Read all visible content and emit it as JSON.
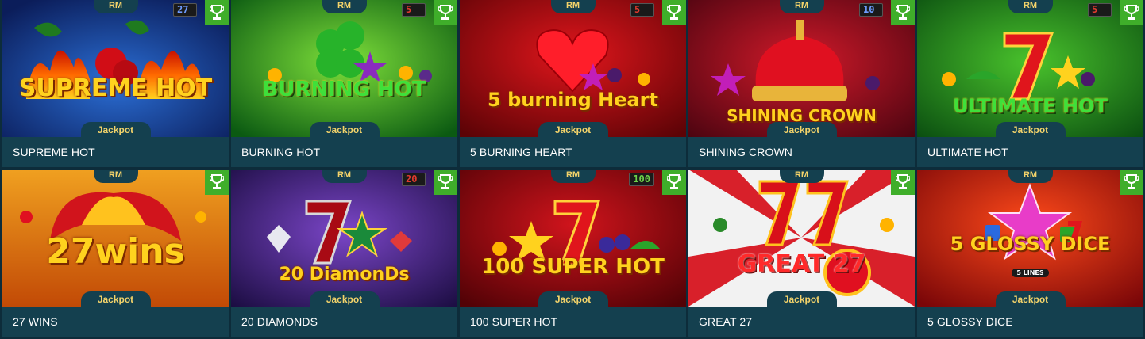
{
  "row1": [
    {
      "title": "SUPREME HOT",
      "badge": "RM",
      "jackpot": "Jackpot",
      "lines": "27",
      "lines_color": "blue",
      "logo": "SUPREME HOT"
    },
    {
      "title": "BURNING HOT",
      "badge": "RM",
      "jackpot": "Jackpot",
      "lines": "5 ",
      "lines_color": "red",
      "logo": "BURNING HOT"
    },
    {
      "title": "5 BURNING HEART",
      "badge": "RM",
      "jackpot": "Jackpot",
      "lines": "5 ",
      "lines_color": "red",
      "logo": "5 burning Heart"
    },
    {
      "title": "SHINING CROWN",
      "badge": "RM",
      "jackpot": "Jackpot",
      "lines": "10 ",
      "lines_color": "blue",
      "logo": "SHINING CROWN"
    },
    {
      "title": "ULTIMATE HOT",
      "badge": "RM",
      "jackpot": "Jackpot",
      "lines": "5 ",
      "lines_color": "red",
      "logo": "ULTIMATE HOT"
    }
  ],
  "row2": [
    {
      "title": "27 WINS",
      "badge": "RM",
      "jackpot": "Jackpot",
      "lines": "",
      "lines_color": "",
      "logo": "27wins"
    },
    {
      "title": "20 DIAMONDS",
      "badge": "RM",
      "jackpot": "Jackpot",
      "lines": "20 ",
      "lines_color": "red",
      "logo": "20 DiamonDs"
    },
    {
      "title": "100 SUPER HOT",
      "badge": "RM",
      "jackpot": "Jackpot",
      "lines": "100 ",
      "lines_color": "green",
      "logo": "100 SUPER HOT"
    },
    {
      "title": "GREAT 27",
      "badge": "RM",
      "jackpot": "Jackpot",
      "lines": "",
      "lines_color": "",
      "logo": "GREAT 27"
    },
    {
      "title": "5 GLOSSY DICE",
      "badge": "RM",
      "jackpot": "Jackpot",
      "lines": "",
      "lines_color": "",
      "logo": "5 GLOSSY DICE",
      "sublogo": "5 LINES"
    }
  ],
  "colors": {
    "caption_bg": "#14404f",
    "badge_text": "#f3d36a",
    "trophy_bg": "#3fae2a"
  },
  "icons": {
    "trophy": "trophy-icon"
  }
}
